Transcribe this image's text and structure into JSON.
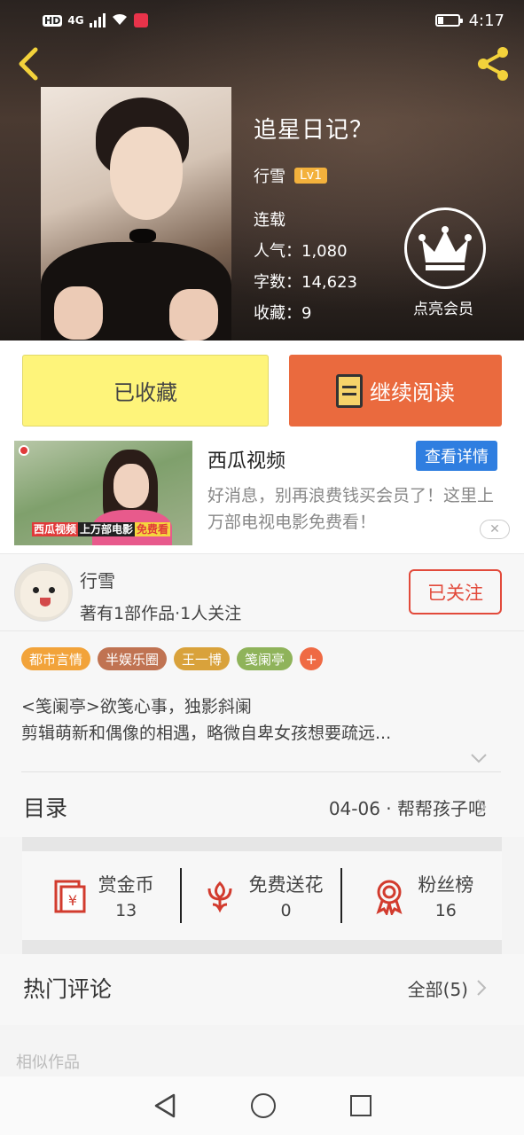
{
  "status_bar": {
    "network": "4G",
    "hd": "HD",
    "time": "4:17"
  },
  "book": {
    "title": "追星日记？",
    "author": "行雪",
    "level": "Lv1",
    "status": "连载",
    "popularity_label": "人气：",
    "popularity": "1,080",
    "words_label": "字数：",
    "words": "14,623",
    "favorites_label": "收藏：",
    "favorites": "9",
    "vip_label": "点亮会员"
  },
  "actions": {
    "favorited_label": "已收藏",
    "continue_label": "继续阅读"
  },
  "ad": {
    "title": "西瓜视频",
    "detail_button": "查看详情",
    "description": "好消息，别再浪费钱买会员了！这里上万部电视电影免费看！",
    "image_caption_1": "西瓜视频",
    "image_caption_2": "上万部电影",
    "image_caption_3": "免费看"
  },
  "author_section": {
    "name": "行雪",
    "stats": "著有1部作品·1人关注",
    "follow_button": "已关注"
  },
  "tags": [
    {
      "label": "都市言情",
      "color": "#f2a33a"
    },
    {
      "label": "半娱乐圈",
      "color": "#c07352"
    },
    {
      "label": "王一博",
      "color": "#d9a23b"
    },
    {
      "label": "笺阑亭",
      "color": "#8fb35a"
    }
  ],
  "tag_add": "+",
  "description": {
    "line1": "<笺阑亭>欲笺心事，独影斜阑",
    "line2": "剪辑萌新和偶像的相遇，略微自卑女孩想要疏远..."
  },
  "toc": {
    "title": "目录",
    "latest": "04-06 · 帮帮孩子吧"
  },
  "stats": [
    {
      "label": "赏金币",
      "value": "13",
      "icon": "red-envelope-icon"
    },
    {
      "label": "免费送花",
      "value": "0",
      "icon": "flower-icon"
    },
    {
      "label": "粉丝榜",
      "value": "16",
      "icon": "medal-icon"
    }
  ],
  "comments": {
    "title": "热门评论",
    "all": "全部(5)"
  },
  "similar": {
    "title": "相似作品"
  },
  "colors": {
    "accent_orange": "#ea6a3e",
    "fav_yellow": "#fef47a",
    "follow_red": "#e24a3b",
    "ad_blue": "#2f7ee0"
  }
}
